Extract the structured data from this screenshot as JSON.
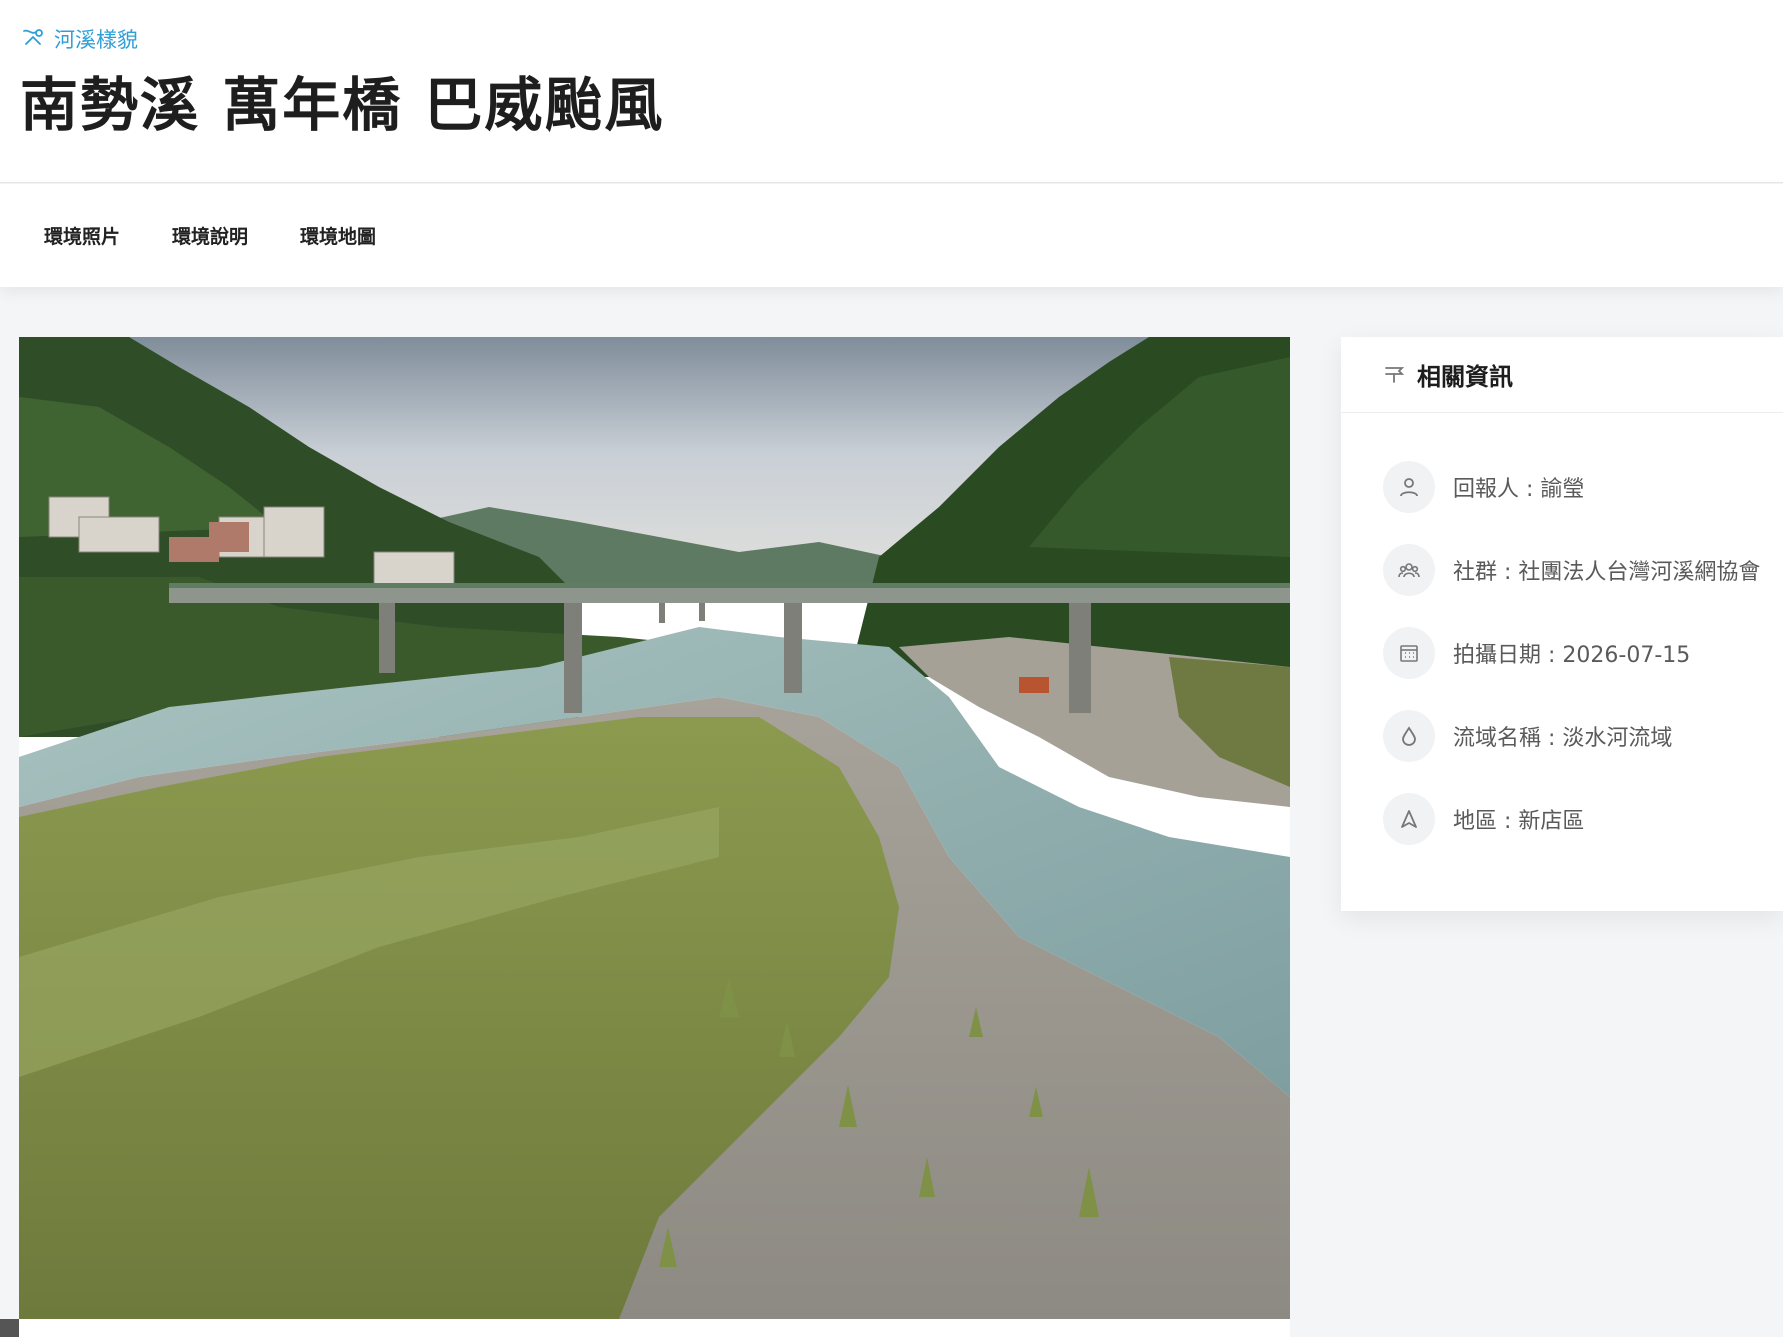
{
  "header": {
    "breadcrumb": "河溪樣貌",
    "title": "南勢溪 萬年橋 巴威颱風"
  },
  "tabs": [
    {
      "label": "環境照片"
    },
    {
      "label": "環境說明"
    },
    {
      "label": "環境地圖"
    }
  ],
  "info": {
    "heading": "相關資訊",
    "items": [
      {
        "icon": "person-icon",
        "text": "回報人 : 諭瑩"
      },
      {
        "icon": "group-icon",
        "text": "社群 : 社團法人台灣河溪網協會"
      },
      {
        "icon": "calendar-icon",
        "text": "拍攝日期 : 2026-07-15"
      },
      {
        "icon": "water-drop-icon",
        "text": "流域名稱 : 淡水河流域"
      },
      {
        "icon": "region-icon",
        "text": "地區 : 新店區"
      }
    ]
  },
  "colors": {
    "accent": "#2f9fd8",
    "page_bg": "#f4f5f7",
    "icon_gray": "#777777"
  }
}
